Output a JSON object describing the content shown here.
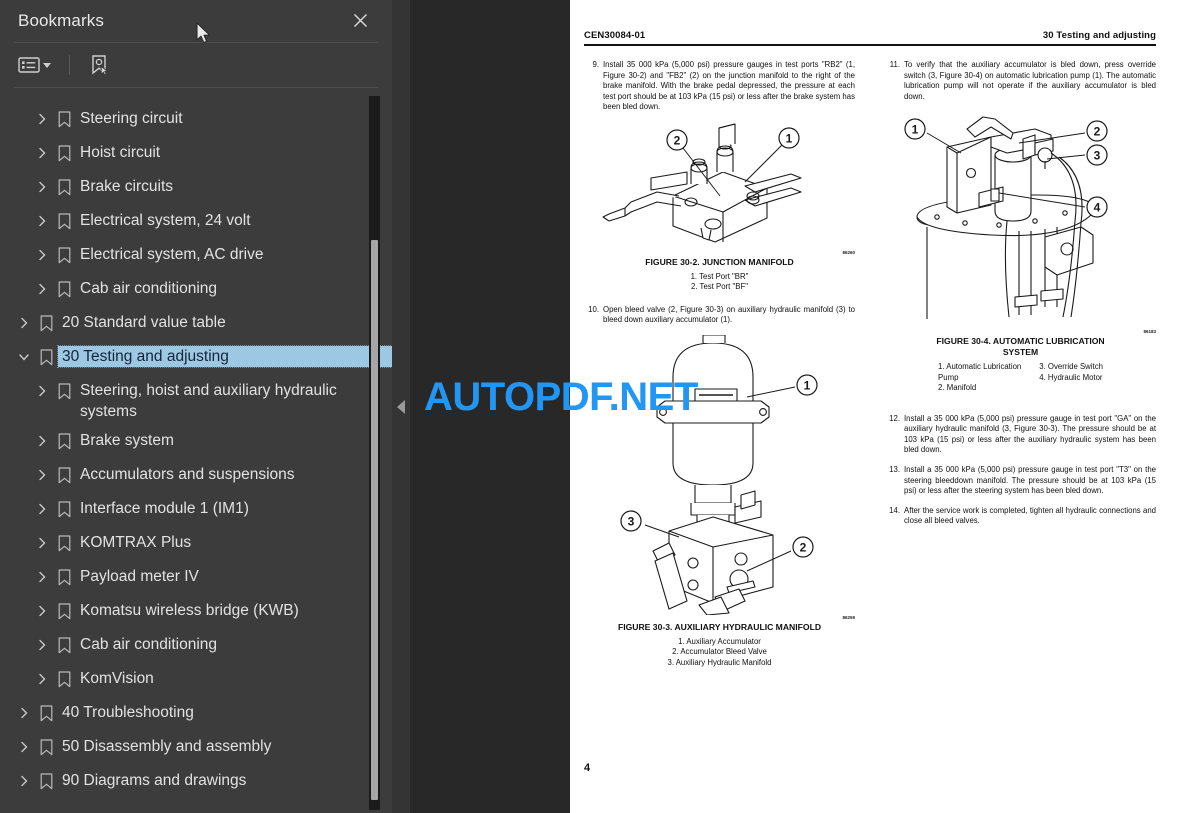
{
  "sidebar": {
    "title": "Bookmarks",
    "close_icon": "close-icon",
    "toolbar": {
      "options_icon": "list-options-icon",
      "new_bookmark_icon": "new-bookmark-icon"
    },
    "items": [
      {
        "label": "Steering circuit",
        "level": 2,
        "expanded": false,
        "selected": false
      },
      {
        "label": "Hoist circuit",
        "level": 2,
        "expanded": false,
        "selected": false
      },
      {
        "label": "Brake circuits",
        "level": 2,
        "expanded": false,
        "selected": false
      },
      {
        "label": "Electrical system, 24 volt",
        "level": 2,
        "expanded": false,
        "selected": false
      },
      {
        "label": "Electrical system, AC drive",
        "level": 2,
        "expanded": false,
        "selected": false
      },
      {
        "label": "Cab air conditioning",
        "level": 2,
        "expanded": false,
        "selected": false
      },
      {
        "label": "20 Standard value table",
        "level": 1,
        "expanded": false,
        "selected": false
      },
      {
        "label": "30 Testing and adjusting",
        "level": 1,
        "expanded": true,
        "selected": true
      },
      {
        "label": "Steering, hoist and auxiliary hydraulic systems",
        "level": 2,
        "expanded": false,
        "selected": false
      },
      {
        "label": "Brake system",
        "level": 2,
        "expanded": false,
        "selected": false
      },
      {
        "label": "Accumulators and suspensions",
        "level": 2,
        "expanded": false,
        "selected": false
      },
      {
        "label": "Interface module 1 (IM1)",
        "level": 2,
        "expanded": false,
        "selected": false
      },
      {
        "label": "KOMTRAX Plus",
        "level": 2,
        "expanded": false,
        "selected": false
      },
      {
        "label": "Payload meter IV",
        "level": 2,
        "expanded": false,
        "selected": false
      },
      {
        "label": "Komatsu wireless bridge (KWB)",
        "level": 2,
        "expanded": false,
        "selected": false
      },
      {
        "label": "Cab air conditioning",
        "level": 2,
        "expanded": false,
        "selected": false
      },
      {
        "label": "KomVision",
        "level": 2,
        "expanded": false,
        "selected": false
      },
      {
        "label": "40 Troubleshooting",
        "level": 1,
        "expanded": false,
        "selected": false
      },
      {
        "label": "50 Disassembly and assembly",
        "level": 1,
        "expanded": false,
        "selected": false
      },
      {
        "label": "90 Diagrams and drawings",
        "level": 1,
        "expanded": false,
        "selected": false
      }
    ],
    "collapse_handle_icon": "collapse-left-icon"
  },
  "watermark": {
    "text": "AUTOPDF.NET",
    "color": "#2196f3"
  },
  "document": {
    "header_left": "CEN30084-01",
    "header_right": "30 Testing and adjusting",
    "page_number": "4",
    "left_column": {
      "step9_num": "9.",
      "step9_text": "Install 35 000 kPa (5,000 psi) pressure gauges in test ports \"RB2\" (1, Figure 30-2) and \"FB2\" (2) on the junction manifold to the right of the brake manifold. With the brake pedal depressed, the pressure at each test port should be at 103 kPa (15 psi) or less after the brake system has been bled down.",
      "figure2": {
        "art_number": "86260",
        "caption": "FIGURE 30-2. JUNCTION MANIFOLD",
        "legend": [
          "1. Test Port \"BR\"",
          "2. Test Port \"BF\""
        ],
        "callouts": [
          "1",
          "2"
        ]
      },
      "step10_num": "10.",
      "step10_text": "Open bleed valve (2, Figure 30-3) on auxiliary hydraulic manifold (3) to bleed down auxiliary accumulator (1).",
      "figure3": {
        "art_number": "86259",
        "caption": "FIGURE 30-3. AUXILIARY HYDRAULIC MANIFOLD",
        "legend": [
          "1. Auxiliary Accumulator",
          "2. Accumulator Bleed Valve",
          "3. Auxiliary Hydraulic Manifold"
        ],
        "callouts": [
          "1",
          "2",
          "3"
        ]
      }
    },
    "right_column": {
      "step11_num": "11.",
      "step11_text": "To verify that the auxiliary accumulator is bled down, press override switch (3, Figure 30-4) on automatic lubrication pump (1). The automatic lubrication pump will not operate if the auxiliary accumulator is bled down.",
      "figure4": {
        "art_number": "86183",
        "caption_line1": "FIGURE 30-4. AUTOMATIC LUBRICATION",
        "caption_line2": "SYSTEM",
        "legend_col1": [
          "1. Automatic Lubrication",
          "      Pump",
          "2. Manifold"
        ],
        "legend_col2": [
          "3. Override Switch",
          "4. Hydraulic Motor"
        ],
        "callouts": [
          "1",
          "2",
          "3",
          "4"
        ]
      },
      "step12_num": "12.",
      "step12_text": "Install a 35 000 kPa (5,000 psi) pressure gauge in test port \"GA\" on the auxiliary hydraulic manifold (3, Figure 30-3). The pressure should be at 103 kPa (15 psi) or less after the auxiliary hydraulic system has been bled down.",
      "step13_num": "13.",
      "step13_text": "Install a 35 000 kPa (5,000 psi) pressure gauge in test port \"T3\" on the steering bleeddown manifold. The pressure should be at 103 kPa (15 psi) or less after the steering system has been bled down.",
      "step14_num": "14.",
      "step14_text": "After the service work is completed, tighten all hydraulic connections and close all bleed valves."
    }
  }
}
